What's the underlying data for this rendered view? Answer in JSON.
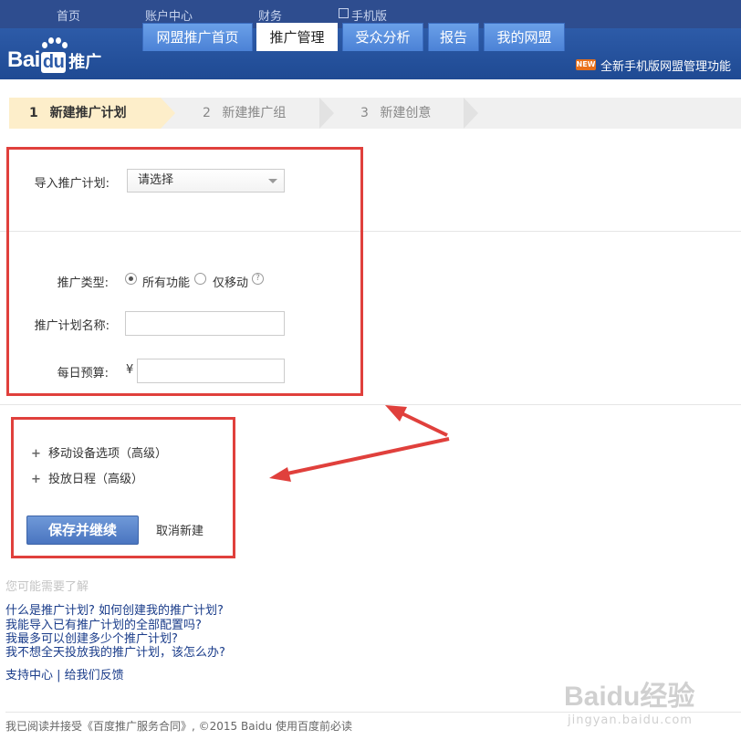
{
  "topnav": {
    "items": [
      "首页",
      "账户中心",
      "财务",
      "手机版"
    ]
  },
  "header": {
    "logo_main": "Bai",
    "logo_du": "du",
    "logo_sub": "推广",
    "tabs": [
      "网盟推广首页",
      "推广管理",
      "受众分析",
      "报告",
      "我的网盟"
    ],
    "new_badge": "NEW",
    "new_text": "全新手机版网盟管理功能"
  },
  "steps": [
    {
      "num": "1",
      "label": "新建推广计划"
    },
    {
      "num": "2",
      "label": "新建推广组"
    },
    {
      "num": "3",
      "label": "新建创意"
    }
  ],
  "form": {
    "import_label": "导入推广计划:",
    "import_value": "请选择",
    "type_label": "推广类型:",
    "type_all": "所有功能",
    "type_mobile": "仅移动",
    "help": "?",
    "name_label": "推广计划名称:",
    "budget_label": "每日预算:",
    "currency": "¥"
  },
  "advanced": {
    "plus": "+",
    "mobile_options": "移动设备选项（高级）",
    "schedule": "投放日程（高级）"
  },
  "actions": {
    "save": "保存并继续",
    "cancel": "取消新建"
  },
  "faq": {
    "title": "您可能需要了解",
    "items": [
      "什么是推广计划? 如何创建我的推广计划?",
      "我能导入已有推广计划的全部配置吗?",
      "我最多可以创建多少个推广计划?",
      "我不想全天投放我的推广计划，该怎么办?"
    ],
    "support": "支持中心 | 给我们反馈"
  },
  "footer": "我已阅读并接受《百度推广服务合同》, ©2015 Baidu 使用百度前必读",
  "watermark": {
    "main": "Baidu经验",
    "sub": "jingyan.baidu.com"
  },
  "colors": {
    "nav": "#2e4d8f",
    "header": "#2d5ba8",
    "annotation": "#e0403c",
    "link": "#1a3c8a"
  }
}
